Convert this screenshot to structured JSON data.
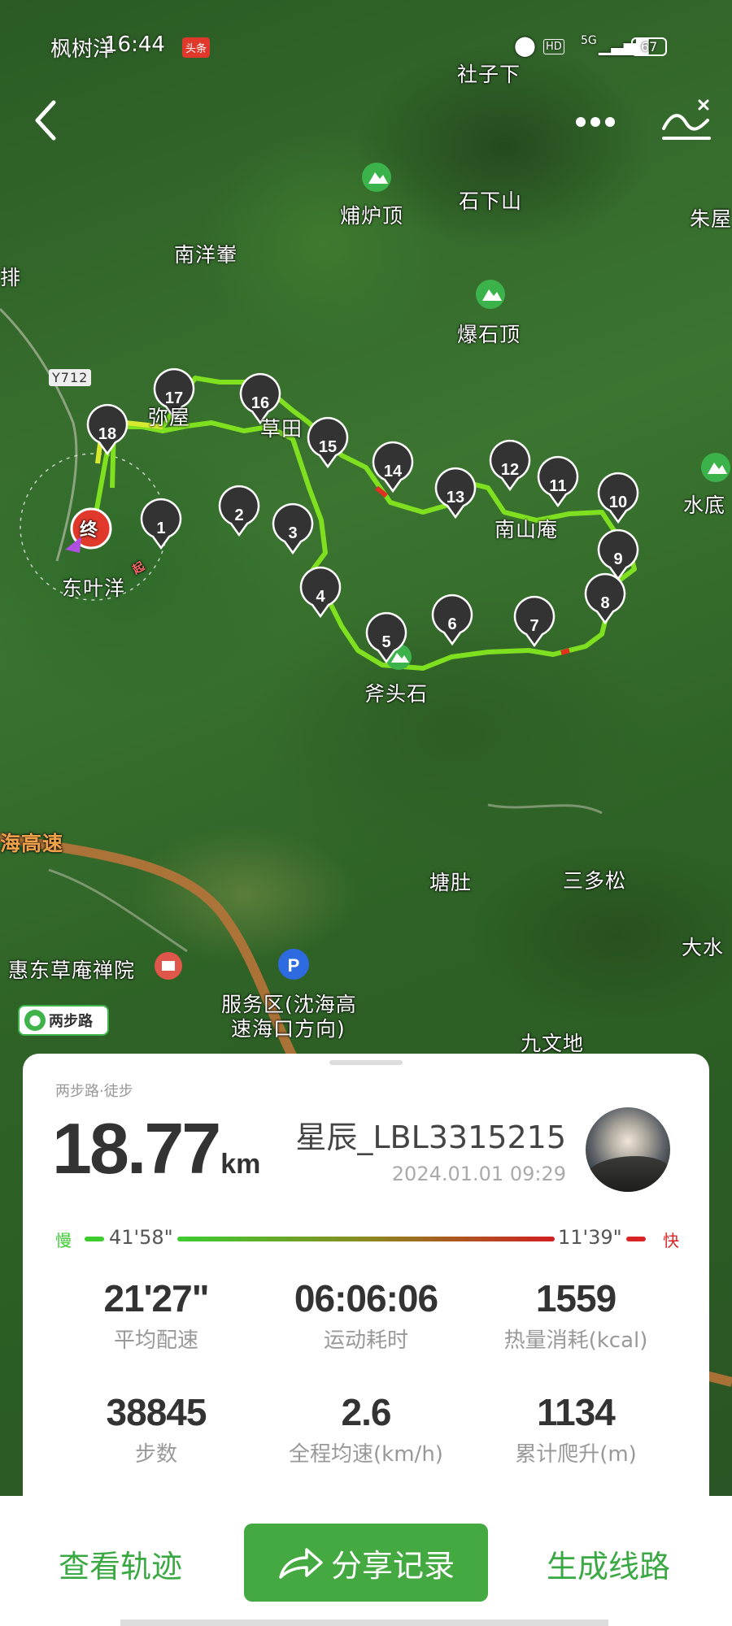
{
  "status_bar": {
    "carrier_text": "枫树洋",
    "time": "16:44",
    "news_badge": "头条",
    "hd": "HD",
    "network": "5G",
    "battery": "67"
  },
  "top_bar": {
    "back_icon": "chevron-left-icon",
    "more_icon": "more-dots-icon",
    "chart_icon": "elevation-chart-icon"
  },
  "map": {
    "places": [
      "社子下",
      "烳炉顶",
      "石下山",
      "朱屋",
      "南洋輋",
      "爆石顶",
      "Y712",
      "弥屋",
      "草田",
      "水底",
      "南山庵",
      "东叶洋",
      "斧头石",
      "海高速",
      "塘肚",
      "三多松",
      "大水",
      "惠东草庵禅院",
      "服务区(沈海高",
      "速海口方向)",
      "九文地",
      "排"
    ],
    "end_marker": "终",
    "start_marker": "起",
    "waypoints": [
      "1",
      "2",
      "3",
      "4",
      "5",
      "6",
      "7",
      "8",
      "9",
      "10",
      "11",
      "12",
      "13",
      "14",
      "15",
      "16",
      "17",
      "18"
    ]
  },
  "brand": {
    "label": "两步路",
    "logo_icon": "two-step-logo-icon"
  },
  "card": {
    "subtitle": "两步路·徒步",
    "distance": "18.77",
    "distance_unit": "km",
    "username": "星辰_LBL3315215",
    "datetime": "2024.01.01 09:29",
    "pace_slow_label": "慢",
    "pace_slow_value": "41'58\"",
    "pace_fast_value": "11'39\"",
    "pace_fast_label": "快",
    "stats": [
      {
        "value": "21'27\"",
        "label": "平均配速"
      },
      {
        "value": "06:06:06",
        "label": "运动耗时"
      },
      {
        "value": "1559",
        "label": "热量消耗(kcal)"
      },
      {
        "value": "38845",
        "label": "步数"
      },
      {
        "value": "2.6",
        "label": "全程均速(km/h)"
      },
      {
        "value": "1134",
        "label": "累计爬升(m)"
      }
    ]
  },
  "bottom_bar": {
    "view_track": "查看轨迹",
    "share": "分享记录",
    "generate_route": "生成线路"
  },
  "colors": {
    "accent": "#43a940",
    "slow": "#3ccc30",
    "fast": "#d82424",
    "end_marker": "#e0392b"
  }
}
